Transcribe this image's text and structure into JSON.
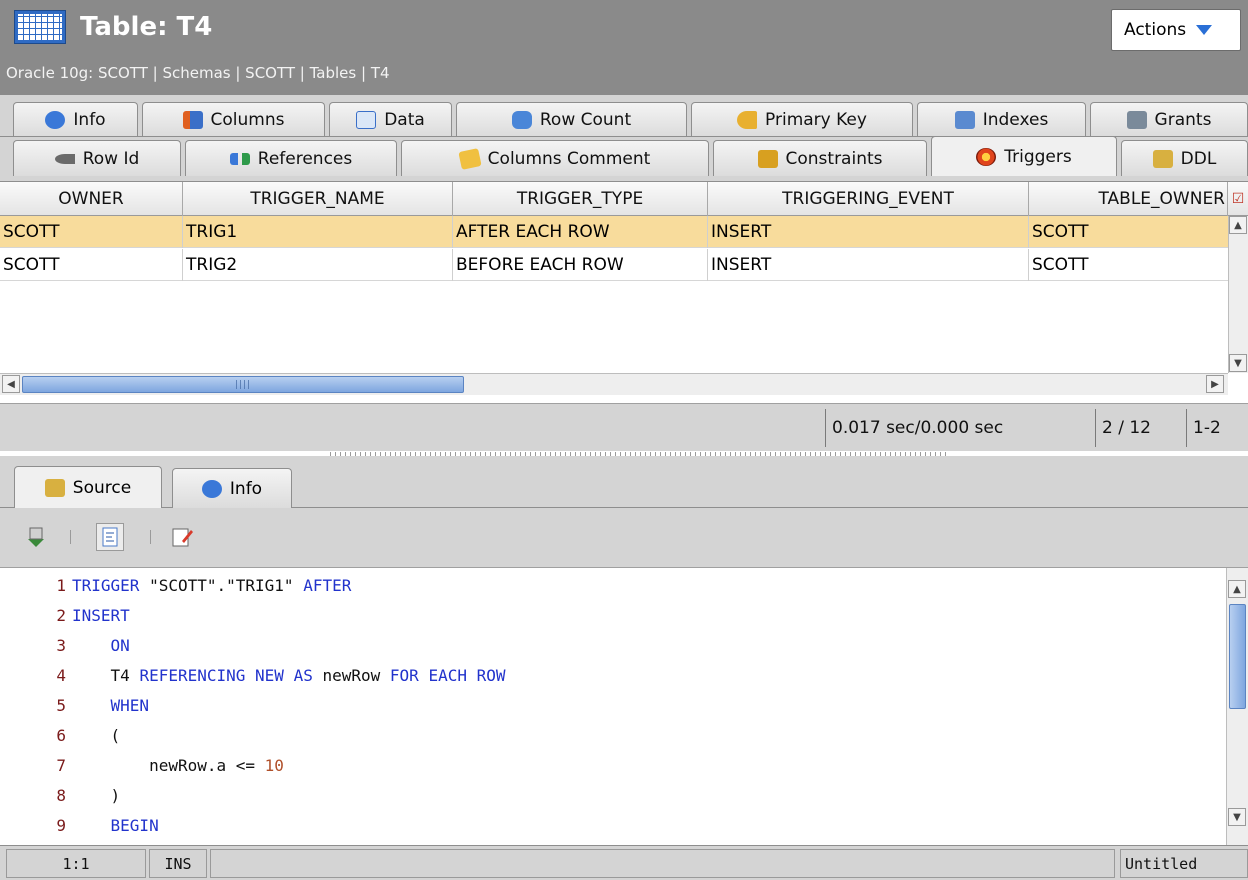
{
  "header": {
    "title": "Table: T4",
    "breadcrumb": "Oracle 10g: SCOTT | Schemas | SCOTT | Tables | T4",
    "actions_label": "Actions"
  },
  "tabs": {
    "row1": [
      "Info",
      "Columns",
      "Data",
      "Row Count",
      "Primary Key",
      "Indexes",
      "Grants"
    ],
    "row2": [
      "Row Id",
      "References",
      "Columns Comment",
      "Constraints",
      "Triggers",
      "DDL"
    ],
    "active": "Triggers"
  },
  "grid": {
    "columns": [
      "OWNER",
      "TRIGGER_NAME",
      "TRIGGER_TYPE",
      "TRIGGERING_EVENT",
      "TABLE_OWNER"
    ],
    "rows": [
      [
        "SCOTT",
        "TRIG1",
        "AFTER EACH ROW",
        "INSERT",
        "SCOTT"
      ],
      [
        "SCOTT",
        "TRIG2",
        "BEFORE EACH ROW",
        "INSERT",
        "SCOTT"
      ]
    ],
    "selected_row": 0
  },
  "grid_status": {
    "timing": "0.017 sec/0.000 sec",
    "count": "2 / 12",
    "range": "1-2"
  },
  "bottom_tabs": [
    "Source",
    "Info"
  ],
  "bottom_active": "Source",
  "editor": {
    "lines": [
      {
        "n": "1",
        "parts": [
          [
            "kw",
            "TRIGGER "
          ],
          [
            "str",
            "\"SCOTT\".\"TRIG1\" "
          ],
          [
            "kw",
            "AFTER"
          ]
        ]
      },
      {
        "n": "2",
        "parts": [
          [
            "kw",
            "INSERT"
          ]
        ]
      },
      {
        "n": "3",
        "parts": [
          [
            "code",
            "    "
          ],
          [
            "kw",
            "ON"
          ]
        ]
      },
      {
        "n": "4",
        "parts": [
          [
            "code",
            "    T4 "
          ],
          [
            "kw",
            "REFERENCING NEW AS "
          ],
          [
            "code",
            "newRow "
          ],
          [
            "kw",
            "FOR EACH ROW"
          ]
        ]
      },
      {
        "n": "5",
        "parts": [
          [
            "code",
            "    "
          ],
          [
            "kw",
            "WHEN"
          ]
        ]
      },
      {
        "n": "6",
        "parts": [
          [
            "code",
            "    ("
          ]
        ]
      },
      {
        "n": "7",
        "parts": [
          [
            "code",
            "        newRow.a <= "
          ],
          [
            "num",
            "10"
          ]
        ]
      },
      {
        "n": "8",
        "parts": [
          [
            "code",
            "    )"
          ]
        ]
      },
      {
        "n": "9",
        "parts": [
          [
            "code",
            "    "
          ],
          [
            "kw",
            "BEGIN"
          ]
        ]
      }
    ]
  },
  "statusbar": {
    "position": "1:1",
    "mode": "INS",
    "file": "Untitled"
  },
  "colors": {
    "header_bg": "#8a8a8a",
    "selected_row": "#f8dc9c",
    "keyword": "#2233cc",
    "number": "#b0502a",
    "line_number": "#7a1a1a"
  }
}
